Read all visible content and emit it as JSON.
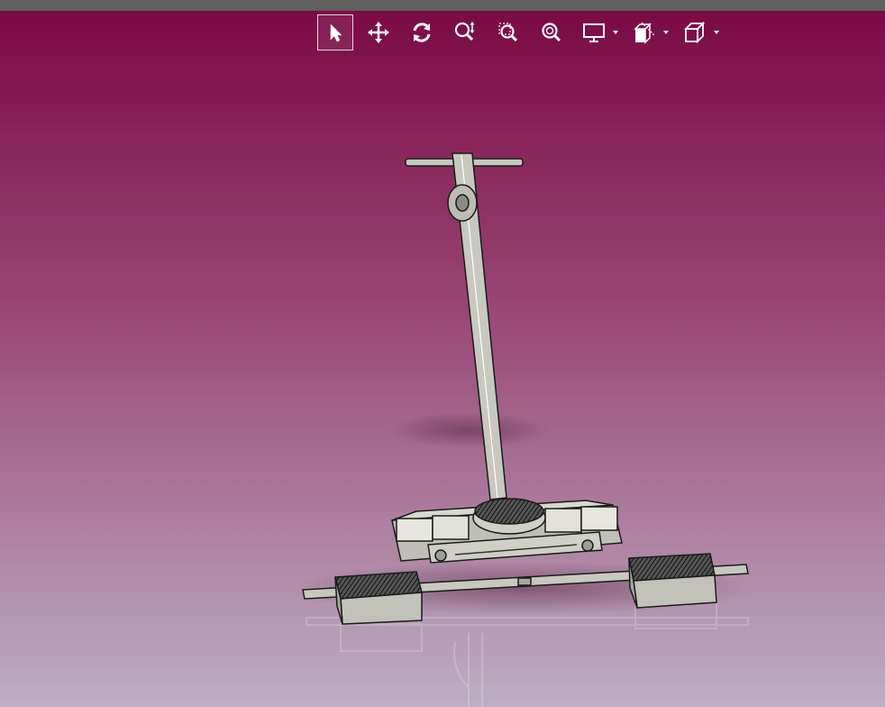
{
  "app": {
    "view": "3d-model-viewer"
  },
  "toolbar": {
    "tools": [
      {
        "id": "select",
        "icon": "cursor-arrow-icon",
        "active": true
      },
      {
        "id": "pan",
        "icon": "move-arrows-icon",
        "active": false
      },
      {
        "id": "rotate",
        "icon": "rotate-icon",
        "active": false
      },
      {
        "id": "zoom-in-out",
        "icon": "zoom-updown-icon",
        "active": false
      },
      {
        "id": "zoom-window",
        "icon": "zoom-window-icon",
        "active": false
      },
      {
        "id": "zoom-fit",
        "icon": "zoom-fit-icon",
        "active": false
      },
      {
        "id": "display-mode",
        "icon": "monitor-icon",
        "dropdown": true
      },
      {
        "id": "section",
        "icon": "section-cut-icon",
        "dropdown": true
      },
      {
        "id": "standard-views",
        "icon": "cube-view-icon",
        "dropdown": true
      }
    ]
  },
  "colors": {
    "background_top": "#7a0a45",
    "background_bottom": "#bdafc4",
    "toolbar_icon": "#ffffff",
    "model_fill": "#c8c8c0",
    "model_stroke": "#1a1a1a"
  }
}
